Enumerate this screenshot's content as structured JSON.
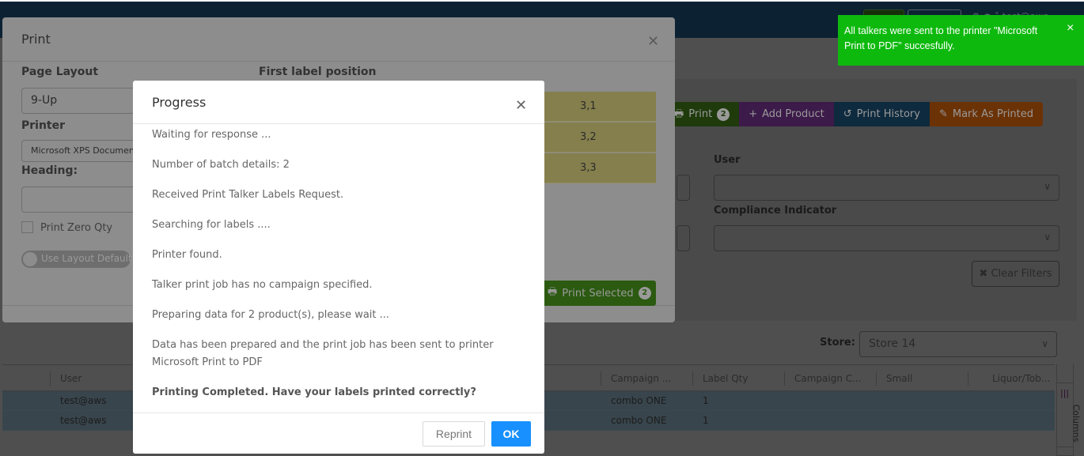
{
  "colors": {
    "toast_bg": "#0eb90e",
    "ok_button": "#1890ff",
    "print_selected": "#2b5a10",
    "topbar": "#0c2233"
  },
  "toolbar": {
    "print_label": "Print",
    "print_count": "2",
    "add_product_label": "Add Product",
    "print_history_label": "Print History",
    "mark_printed_label": "Mark As Printed"
  },
  "filters": {
    "user_label": "User",
    "user_value": "",
    "compliance_label": "Compliance Indicator",
    "compliance_value": "",
    "clear_label": "Clear Filters"
  },
  "store": {
    "label": "Store:",
    "value": "Store 14"
  },
  "grid": {
    "columns": [
      "User",
      "Campaign ...",
      "Label Qty",
      "Campaign C...",
      "Small",
      "Liquor/Tob..."
    ],
    "rows": [
      {
        "user": "test@aws",
        "campaign": "combo ONE",
        "label_qty": "1"
      },
      {
        "user": "test@aws",
        "campaign": "combo ONE",
        "label_qty": "1"
      }
    ],
    "columns_panel_label": "Columns"
  },
  "print_modal": {
    "title": "Print",
    "page_layout_label": "Page Layout",
    "page_layout_value": "9-Up",
    "printer_label": "Printer",
    "printer_value": "Microsoft XPS Document Writer",
    "heading_label": "Heading:",
    "heading_value": "",
    "print_zero_qty_label": "Print Zero Qty",
    "print_zero_qty_checked": false,
    "use_layout_default_label": "Use Layout Default",
    "first_label_position_label": "First label position",
    "positions": [
      "3,1",
      "3,2",
      "3,3"
    ],
    "print_selected_label": "Print Selected",
    "print_selected_count": "2"
  },
  "progress_modal": {
    "title": "Progress",
    "lines": [
      "Waiting for response ...",
      "Number of batch details: 2",
      "Received Print Talker Labels Request.",
      "Searching for labels ....",
      "Printer found.",
      "Talker print job has no campaign specified.",
      "Preparing data for 2 product(s), please wait ...",
      "Data has been prepared and the print job has been sent to printer Microsoft Print to PDF"
    ],
    "final_line": "Printing Completed. Have your labels printed correctly?",
    "reprint_label": "Reprint",
    "ok_label": "OK"
  },
  "toast": {
    "message": "All talkers were sent to the printer \"Microsoft Print to PDF\" succesfully.",
    "close_icon": "×"
  }
}
